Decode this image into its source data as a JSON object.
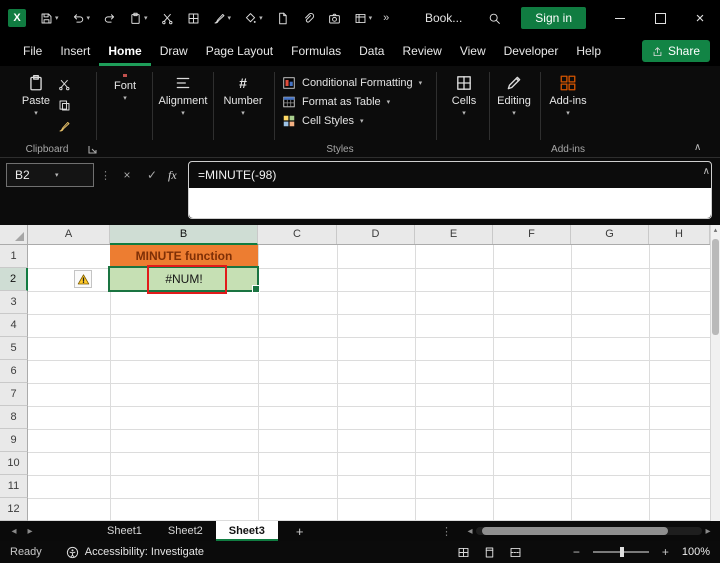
{
  "app": {
    "accent_green": "#107C41"
  },
  "titlebar": {
    "workbook": "Book...",
    "signin_label": "Sign in",
    "qat_icons": [
      "excel-logo",
      "save",
      "undo",
      "redo",
      "paste",
      "cut",
      "borders",
      "format-painter",
      "fill-color",
      "new-document",
      "attach",
      "camera",
      "table",
      "more-commands",
      "search"
    ],
    "window_icons": [
      "minimize",
      "maximize",
      "close"
    ]
  },
  "ribbon_tabs": {
    "items": [
      "File",
      "Insert",
      "Home",
      "Draw",
      "Page Layout",
      "Formulas",
      "Data",
      "Review",
      "View",
      "Developer",
      "Help"
    ],
    "active": "Home",
    "share_label": "Share"
  },
  "ribbon": {
    "paste_label": "Paste",
    "font_label": "Font",
    "alignment_label": "Alignment",
    "number_label": "Number",
    "conditional_formatting_label": "Conditional Formatting",
    "format_as_table_label": "Format as Table",
    "cell_styles_label": "Cell Styles",
    "cells_label": "Cells",
    "editing_label": "Editing",
    "addins_label": "Add-ins",
    "groups": {
      "clipboard": "Clipboard",
      "styles": "Styles",
      "addins": "Add-ins"
    }
  },
  "formula_bar": {
    "name_box": "B2",
    "fx_label": "fx",
    "formula": "=MINUTE(-98)"
  },
  "grid": {
    "columns": [
      "A",
      "B",
      "C",
      "D",
      "E",
      "F",
      "G",
      "H"
    ],
    "rows": [
      "1",
      "2",
      "3",
      "4",
      "5",
      "6",
      "7",
      "8",
      "9",
      "10",
      "11",
      "12"
    ],
    "cells": [
      {
        "ref": "B1",
        "text": "MINUTE function",
        "fill": "#ED7D31"
      },
      {
        "ref": "B2",
        "text": "#NUM!",
        "fill": "#C6E0B4"
      }
    ],
    "selected_cell": "B2",
    "annotation": {
      "type": "red-box",
      "color": "#E11B1B",
      "target": "B2"
    },
    "error_indicator": "warning-triangle"
  },
  "sheet_bar": {
    "tabs": [
      "Sheet1",
      "Sheet2",
      "Sheet3"
    ],
    "active": "Sheet3"
  },
  "status_bar": {
    "ready_label": "Ready",
    "accessibility_label": "Accessibility: Investigate",
    "zoom_level": "100%"
  }
}
